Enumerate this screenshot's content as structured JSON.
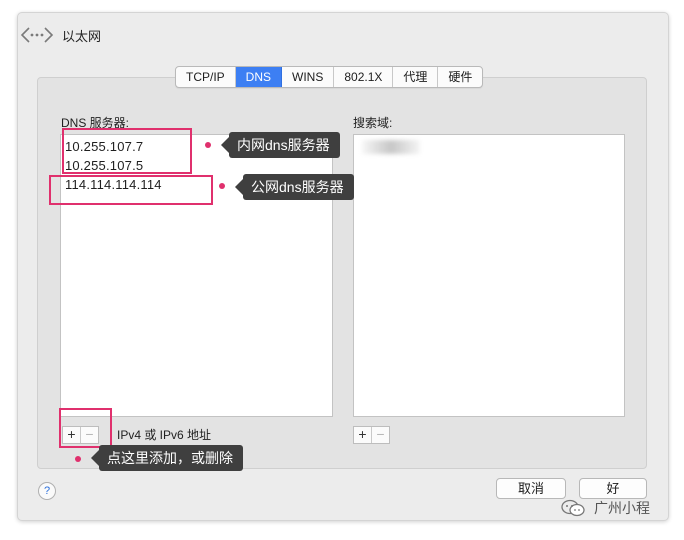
{
  "window": {
    "title": "以太网"
  },
  "tabs": [
    {
      "label": "TCP/IP",
      "active": false
    },
    {
      "label": "DNS",
      "active": true
    },
    {
      "label": "WINS",
      "active": false
    },
    {
      "label": "802.1X",
      "active": false
    },
    {
      "label": "代理",
      "active": false
    },
    {
      "label": "硬件",
      "active": false
    }
  ],
  "dns": {
    "label": "DNS 服务器:",
    "servers": [
      "10.255.107.7",
      "10.255.107.5",
      "114.114.114.114"
    ]
  },
  "search": {
    "label": "搜索域:"
  },
  "controls": {
    "plus": "+",
    "minus": "−",
    "ip_note": "IPv4 或 IPv6 地址"
  },
  "buttons": {
    "cancel": "取消",
    "ok": "好",
    "help": "?"
  },
  "annotations": {
    "internal": "内网dns服务器",
    "public": "公网dns服务器",
    "add_remove": "点这里添加，或删除"
  },
  "watermark": {
    "text": "广州小程"
  },
  "colors": {
    "accent": "#3d7ff3",
    "annotation": "#e0306d",
    "callout_bg": "#3f3f3f"
  },
  "icons": {
    "network": "network-arrows-icon",
    "watermark": "wechat-icon"
  }
}
